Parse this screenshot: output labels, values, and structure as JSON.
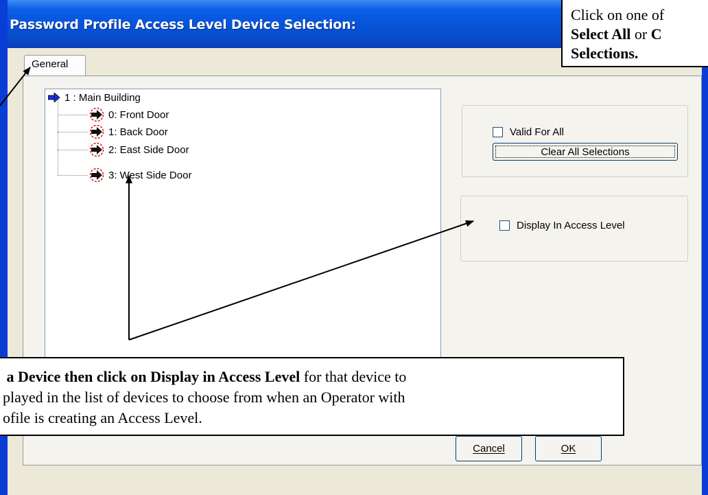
{
  "window": {
    "title": "Password Profile Access Level Device Selection:"
  },
  "tabs": [
    {
      "label": "General"
    }
  ],
  "tree": {
    "root": {
      "label": "1 : Main Building"
    },
    "children": [
      {
        "label": "0: Front Door"
      },
      {
        "label": "1: Back Door"
      },
      {
        "label": "2: East Side Door"
      },
      {
        "label": "3: West Side Door"
      }
    ]
  },
  "options": {
    "valid_for_all_label": "Valid For All",
    "valid_for_all_checked": false,
    "clear_all_label": "Clear All Selections",
    "display_in_access_level_label": "Display In Access Level",
    "display_in_access_level_checked": false
  },
  "buttons": {
    "cancel_label": "Cancel",
    "ok_label": "OK"
  },
  "callouts": {
    "top": {
      "line1": "Click on one of",
      "line2_bold_a": "Select All",
      "line2_mid": " or ",
      "line2_bold_b": "C",
      "line3_bold": "Selections."
    },
    "bottom": {
      "line1_bold": " a Device then click on Display in Access Level",
      "line1_rest": " for that device to",
      "line2": "played in the list of devices to choose from when an Operator with",
      "line3": "ofile is creating an Access Level."
    }
  },
  "colors": {
    "titlebar": "#0653d7",
    "dialog_bg": "#ece9d8",
    "root_icon": "#1a2fe0",
    "door_icon_ring": "#e01010"
  },
  "icons": {
    "root": "blue-arrow-icon",
    "door": "door-reader-icon"
  }
}
